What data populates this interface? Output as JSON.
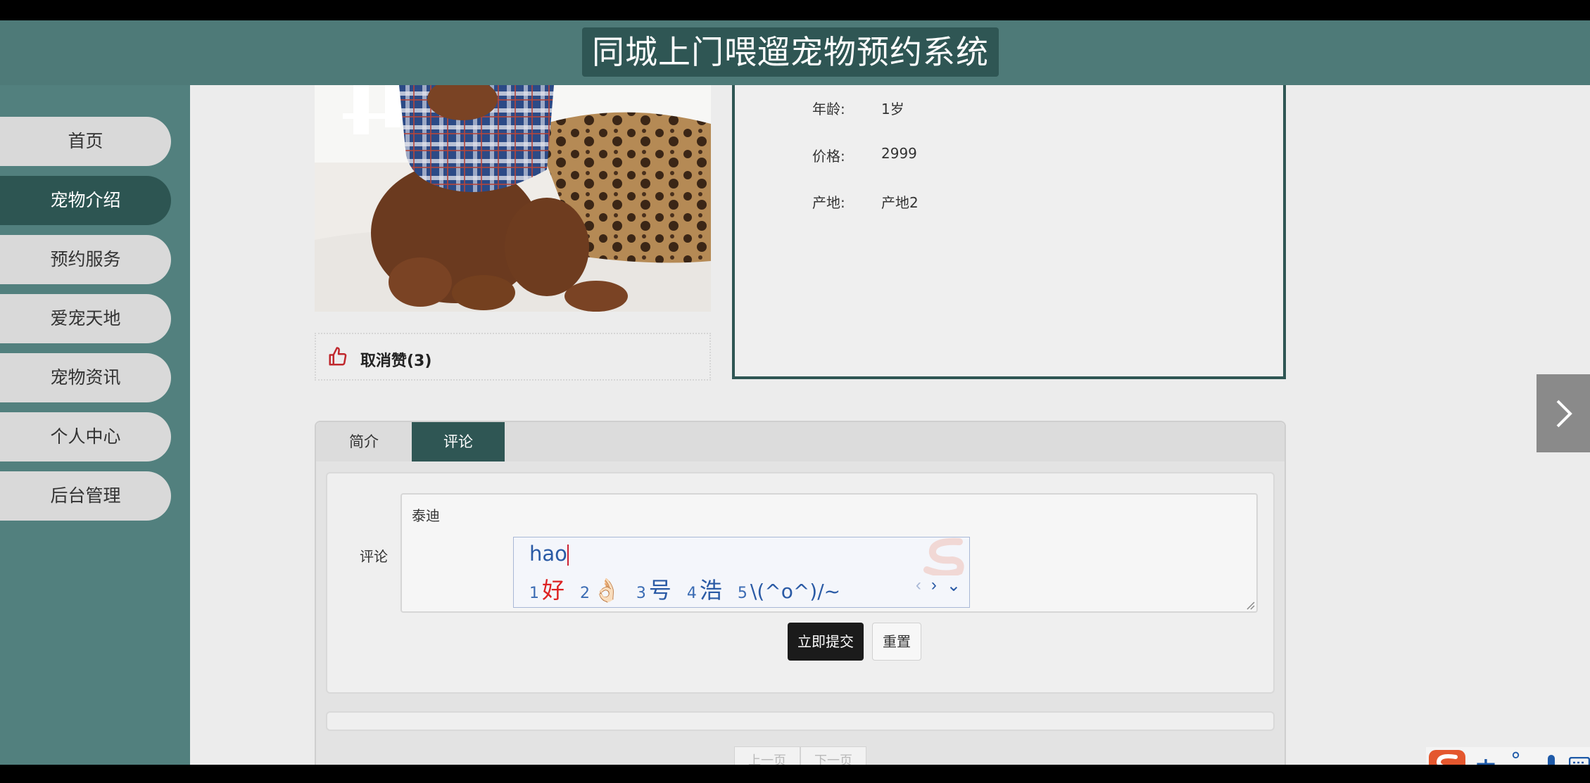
{
  "header": {
    "title": "同城上门喂遛宠物预约系统"
  },
  "sidebar": {
    "items": [
      {
        "label": "首页"
      },
      {
        "label": "宠物介绍"
      },
      {
        "label": "预约服务"
      },
      {
        "label": "爱宠天地"
      },
      {
        "label": "宠物资讯"
      },
      {
        "label": "个人中心"
      },
      {
        "label": "后台管理"
      }
    ]
  },
  "pet": {
    "photo_icon": "poodle-in-plaid-shirt",
    "fields": [
      {
        "label": "年龄:",
        "value": "1岁"
      },
      {
        "label": "价格:",
        "value": "2999"
      },
      {
        "label": "产地:",
        "value": "产地2"
      }
    ]
  },
  "like": {
    "label": "取消赞(3)",
    "icon": "thumbs-up-icon"
  },
  "tabs": [
    {
      "label": "简介"
    },
    {
      "label": "评论"
    }
  ],
  "comment_form": {
    "label": "评论",
    "value": "泰迪",
    "submit_label": "立即提交",
    "reset_label": "重置"
  },
  "ime": {
    "input": "hao",
    "candidates": [
      {
        "num": "1",
        "text": "好"
      },
      {
        "num": "2",
        "text": "👌🏻"
      },
      {
        "num": "3",
        "text": "号"
      },
      {
        "num": "4",
        "text": "浩"
      },
      {
        "num": "5",
        "text": "\\(^o^)/~"
      }
    ],
    "toolbar": {
      "lang": "中",
      "punct": "°,"
    }
  },
  "pager": {
    "prev": "上一页",
    "next": "下一页"
  },
  "colors": {
    "accent": "#2f5654",
    "sidebar": "#52807e",
    "header": "#4e7a78"
  }
}
